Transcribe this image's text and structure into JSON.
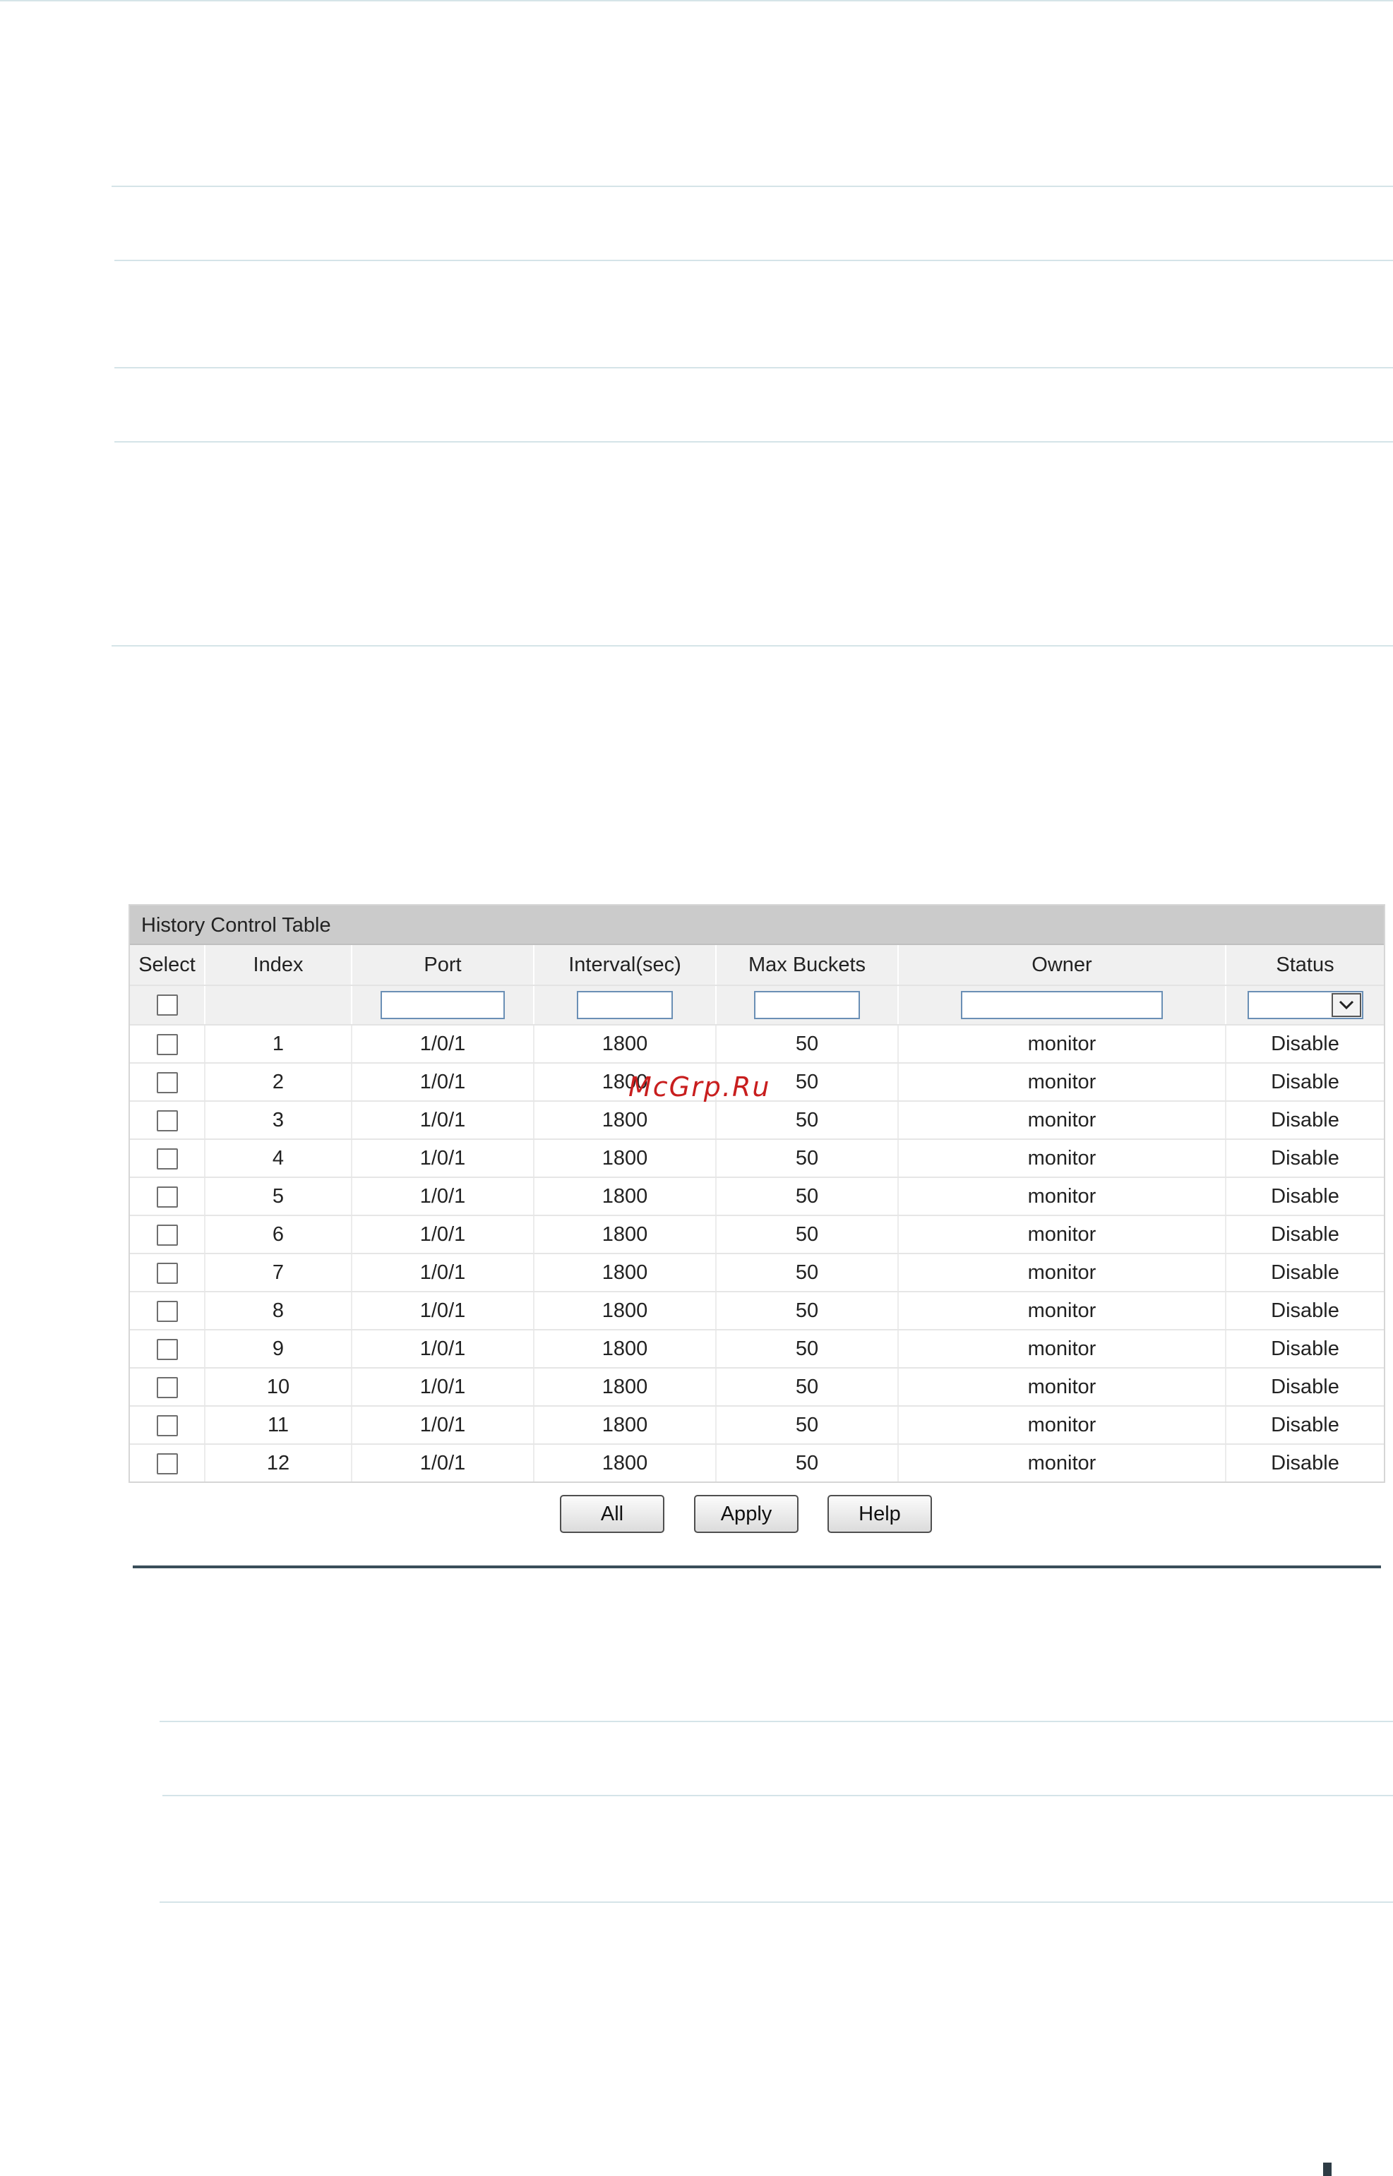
{
  "panel": {
    "title": "History Control Table",
    "columns": [
      "Select",
      "Index",
      "Port",
      "Interval(sec)",
      "Max Buckets",
      "Owner",
      "Status"
    ]
  },
  "rows": [
    {
      "index": "1",
      "port": "1/0/1",
      "interval": "1800",
      "max_buckets": "50",
      "owner": "monitor",
      "status": "Disable"
    },
    {
      "index": "2",
      "port": "1/0/1",
      "interval": "1800",
      "max_buckets": "50",
      "owner": "monitor",
      "status": "Disable"
    },
    {
      "index": "3",
      "port": "1/0/1",
      "interval": "1800",
      "max_buckets": "50",
      "owner": "monitor",
      "status": "Disable"
    },
    {
      "index": "4",
      "port": "1/0/1",
      "interval": "1800",
      "max_buckets": "50",
      "owner": "monitor",
      "status": "Disable"
    },
    {
      "index": "5",
      "port": "1/0/1",
      "interval": "1800",
      "max_buckets": "50",
      "owner": "monitor",
      "status": "Disable"
    },
    {
      "index": "6",
      "port": "1/0/1",
      "interval": "1800",
      "max_buckets": "50",
      "owner": "monitor",
      "status": "Disable"
    },
    {
      "index": "7",
      "port": "1/0/1",
      "interval": "1800",
      "max_buckets": "50",
      "owner": "monitor",
      "status": "Disable"
    },
    {
      "index": "8",
      "port": "1/0/1",
      "interval": "1800",
      "max_buckets": "50",
      "owner": "monitor",
      "status": "Disable"
    },
    {
      "index": "9",
      "port": "1/0/1",
      "interval": "1800",
      "max_buckets": "50",
      "owner": "monitor",
      "status": "Disable"
    },
    {
      "index": "10",
      "port": "1/0/1",
      "interval": "1800",
      "max_buckets": "50",
      "owner": "monitor",
      "status": "Disable"
    },
    {
      "index": "11",
      "port": "1/0/1",
      "interval": "1800",
      "max_buckets": "50",
      "owner": "monitor",
      "status": "Disable"
    },
    {
      "index": "12",
      "port": "1/0/1",
      "interval": "1800",
      "max_buckets": "50",
      "owner": "monitor",
      "status": "Disable"
    }
  ],
  "buttons": {
    "all": "All",
    "apply": "Apply",
    "help": "Help"
  },
  "watermark": "McGrp.Ru",
  "colors": {
    "header_bar": "#cbcbcb",
    "input_border": "#6a8fb5",
    "divider": "#3a4e5a",
    "watermark": "#c81e1e"
  }
}
